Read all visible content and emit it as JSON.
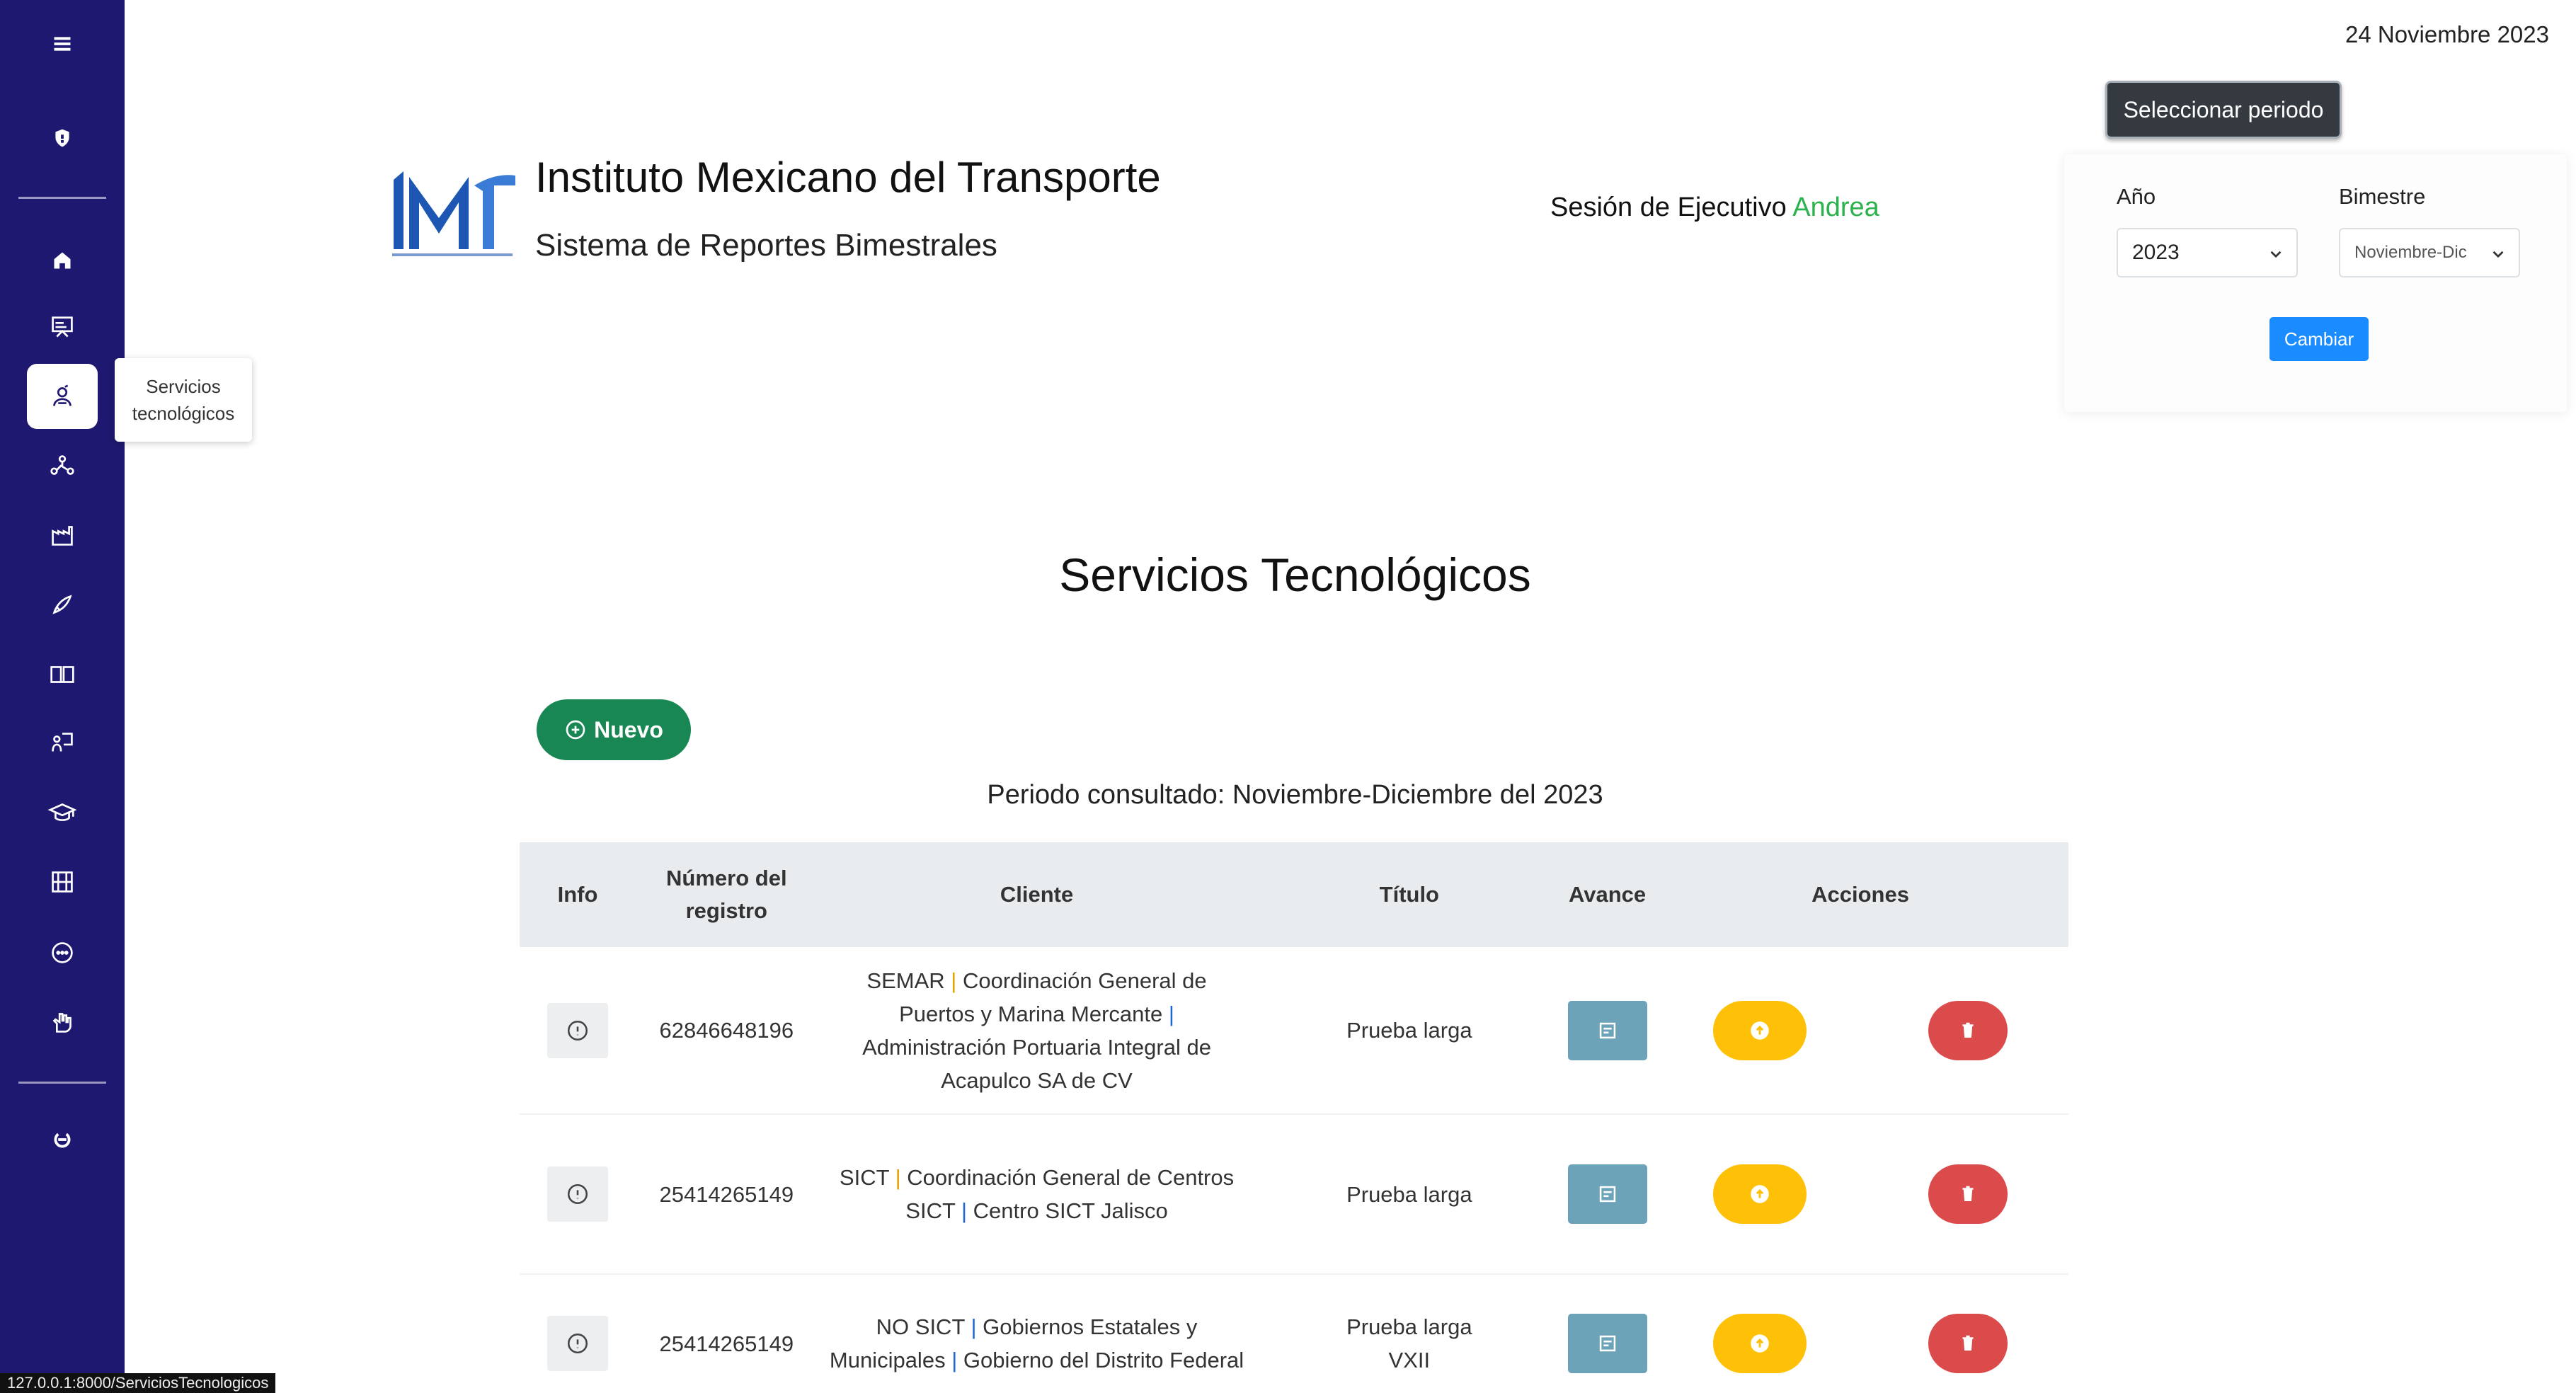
{
  "header": {
    "date": "24 Noviembre 2023",
    "institute_title": "Instituto Mexicano del Transporte",
    "system_subtitle": "Sistema de Reportes Bimestrales",
    "session_prefix": "Sesión de Ejecutivo",
    "session_user": "Andrea"
  },
  "period_selector": {
    "button_label": "Seleccionar periodo",
    "year_label": "Año",
    "year_value": "2023",
    "bimester_label": "Bimestre",
    "bimester_value": "Noviembre-Dic",
    "change_label": "Cambiar"
  },
  "sidebar": {
    "tooltip": "Servicios tecnológicos",
    "items": [
      {
        "icon": "menu-icon"
      },
      {
        "icon": "shield-icon"
      },
      {
        "icon": "home-icon"
      },
      {
        "icon": "presentation-icon"
      },
      {
        "icon": "tech-services-icon",
        "active": true
      },
      {
        "icon": "network-icon"
      },
      {
        "icon": "factory-icon"
      },
      {
        "icon": "rocket-icon"
      },
      {
        "icon": "book-icon"
      },
      {
        "icon": "teaching-icon"
      },
      {
        "icon": "graduation-icon"
      },
      {
        "icon": "map-icon"
      },
      {
        "icon": "more-icon"
      },
      {
        "icon": "hand-icon"
      },
      {
        "icon": "logout-icon"
      }
    ]
  },
  "main": {
    "title": "Servicios Tecnológicos",
    "new_button": "Nuevo",
    "period_consulted": "Periodo consultado: Noviembre-Diciembre del 2023"
  },
  "table": {
    "columns": [
      "Info",
      "Número del registro",
      "Cliente",
      "Título",
      "Avance",
      "Acciones"
    ],
    "rows": [
      {
        "registro": "62846648196",
        "cliente_a": "SEMAR",
        "cliente_b": "Coordinación General de Puertos y Marina Mercante",
        "cliente_c": "Administración Portuaria Integral de Acapulco SA de CV",
        "titulo": "Prueba larga"
      },
      {
        "registro": "25414265149",
        "cliente_a": "SICT",
        "cliente_b": "Coordinación General de Centros SICT",
        "cliente_c": "Centro SICT Jalisco",
        "titulo": "Prueba larga"
      },
      {
        "registro": "25414265149",
        "cliente_a": "NO SICT",
        "cliente_b": "Gobiernos Estatales y Municipales",
        "cliente_c": "Gobierno del Distrito Federal",
        "titulo": "Prueba larga VXII"
      }
    ]
  },
  "status_url": "127.0.0.1:8000/ServiciosTecnologicos",
  "colors": {
    "sidebar": "#1f1870",
    "new_button": "#198754",
    "avance": "#6ca3b8",
    "upload": "#ffc107",
    "delete": "#dc4b4b",
    "session_user": "#2bb24c"
  }
}
